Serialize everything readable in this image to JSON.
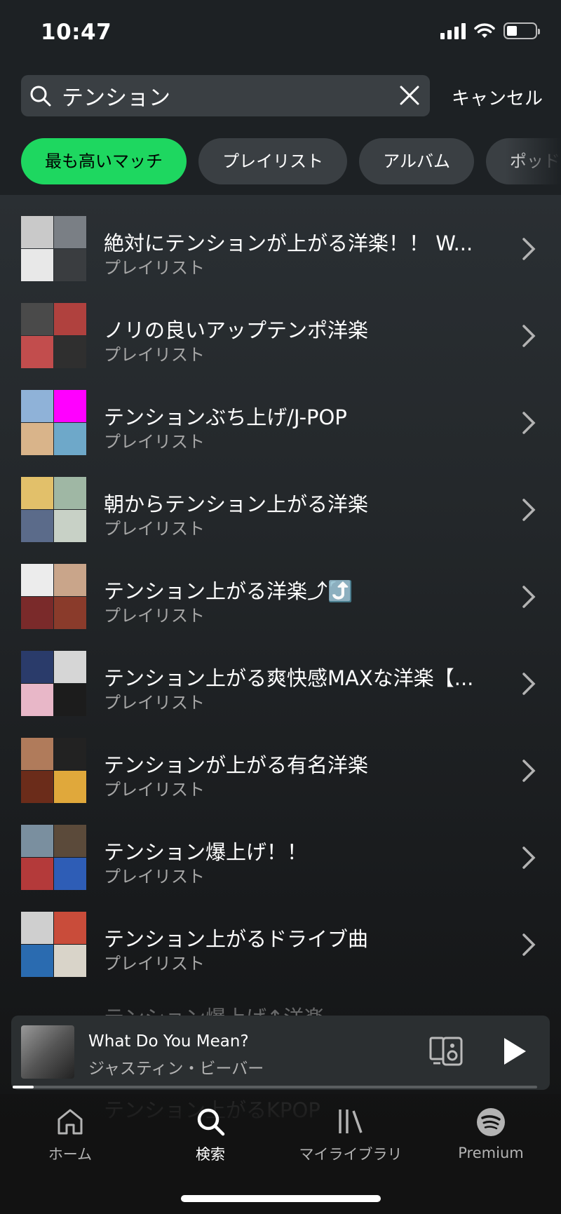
{
  "status_bar": {
    "time": "10:47"
  },
  "search": {
    "query": "テンション",
    "placeholder": "",
    "cancel_label": "キャンセル"
  },
  "filters": [
    {
      "label": "最も高いマッチ",
      "active": true
    },
    {
      "label": "プレイリスト",
      "active": false
    },
    {
      "label": "アルバム",
      "active": false
    },
    {
      "label": "ポッドキャスト",
      "active": false
    }
  ],
  "results": [
    {
      "title": "絶対にテンションが上がる洋楽！！ W...",
      "subtitle": "プレイリスト"
    },
    {
      "title": "ノリの良いアップテンポ洋楽",
      "subtitle": "プレイリスト"
    },
    {
      "title": "テンションぶち上げ/J-POP",
      "subtitle": "プレイリスト"
    },
    {
      "title": "朝からテンション上がる洋楽",
      "subtitle": "プレイリスト"
    },
    {
      "title": "テンション上がる洋楽⤴︎⤴️",
      "subtitle": "プレイリスト"
    },
    {
      "title": "テンション上がる爽快感MAXな洋楽【...",
      "subtitle": "プレイリスト"
    },
    {
      "title": "テンションが上がる有名洋楽",
      "subtitle": "プレイリスト"
    },
    {
      "title": "テンション爆上げ！！",
      "subtitle": "プレイリスト"
    },
    {
      "title": "テンション上がるドライブ曲",
      "subtitle": "プレイリスト"
    }
  ],
  "peek_rows": [
    {
      "title": "テンション爆上げ↑洋楽"
    },
    {
      "title": "テンション上がるKPOP"
    }
  ],
  "now_playing": {
    "title": "What Do You Mean?",
    "artist": "ジャスティン・ビーバー",
    "progress": 0.04
  },
  "nav": [
    {
      "label": "ホーム",
      "icon": "home-icon",
      "active": false
    },
    {
      "label": "検索",
      "icon": "search-icon",
      "active": true
    },
    {
      "label": "マイライブラリ",
      "icon": "library-icon",
      "active": false
    },
    {
      "label": "Premium",
      "icon": "spotify-icon",
      "active": false
    }
  ],
  "colors": {
    "accent": "#1ed760",
    "background": "#121212",
    "chip": "#3a3f43"
  },
  "thumb_colors": [
    [
      "#c9c9c9",
      "#7a7f85",
      "#e8e8e8",
      "#3a3d40"
    ],
    [
      "#4a4a4a",
      "#b0413e",
      "#c24d4d",
      "#2f2f2f"
    ],
    [
      "#8fb2d8",
      "#ff00ff",
      "#d9b48a",
      "#6ea8c9"
    ],
    [
      "#e2c06a",
      "#9fb7a4",
      "#5b6b8a",
      "#c8d1c6"
    ],
    [
      "#ececec",
      "#c9a58a",
      "#7a2a2a",
      "#8a3b2b"
    ],
    [
      "#2a3b6a",
      "#d6d6d6",
      "#e8b7c8",
      "#1c1c1c"
    ],
    [
      "#b07b5b",
      "#222222",
      "#6b2c1a",
      "#e0a83b"
    ],
    [
      "#7a8f9f",
      "#5b4a3a",
      "#b43a3a",
      "#2e5db6"
    ],
    [
      "#cfcfcf",
      "#c94c3a",
      "#2a6bb0",
      "#d9d4c9"
    ]
  ]
}
